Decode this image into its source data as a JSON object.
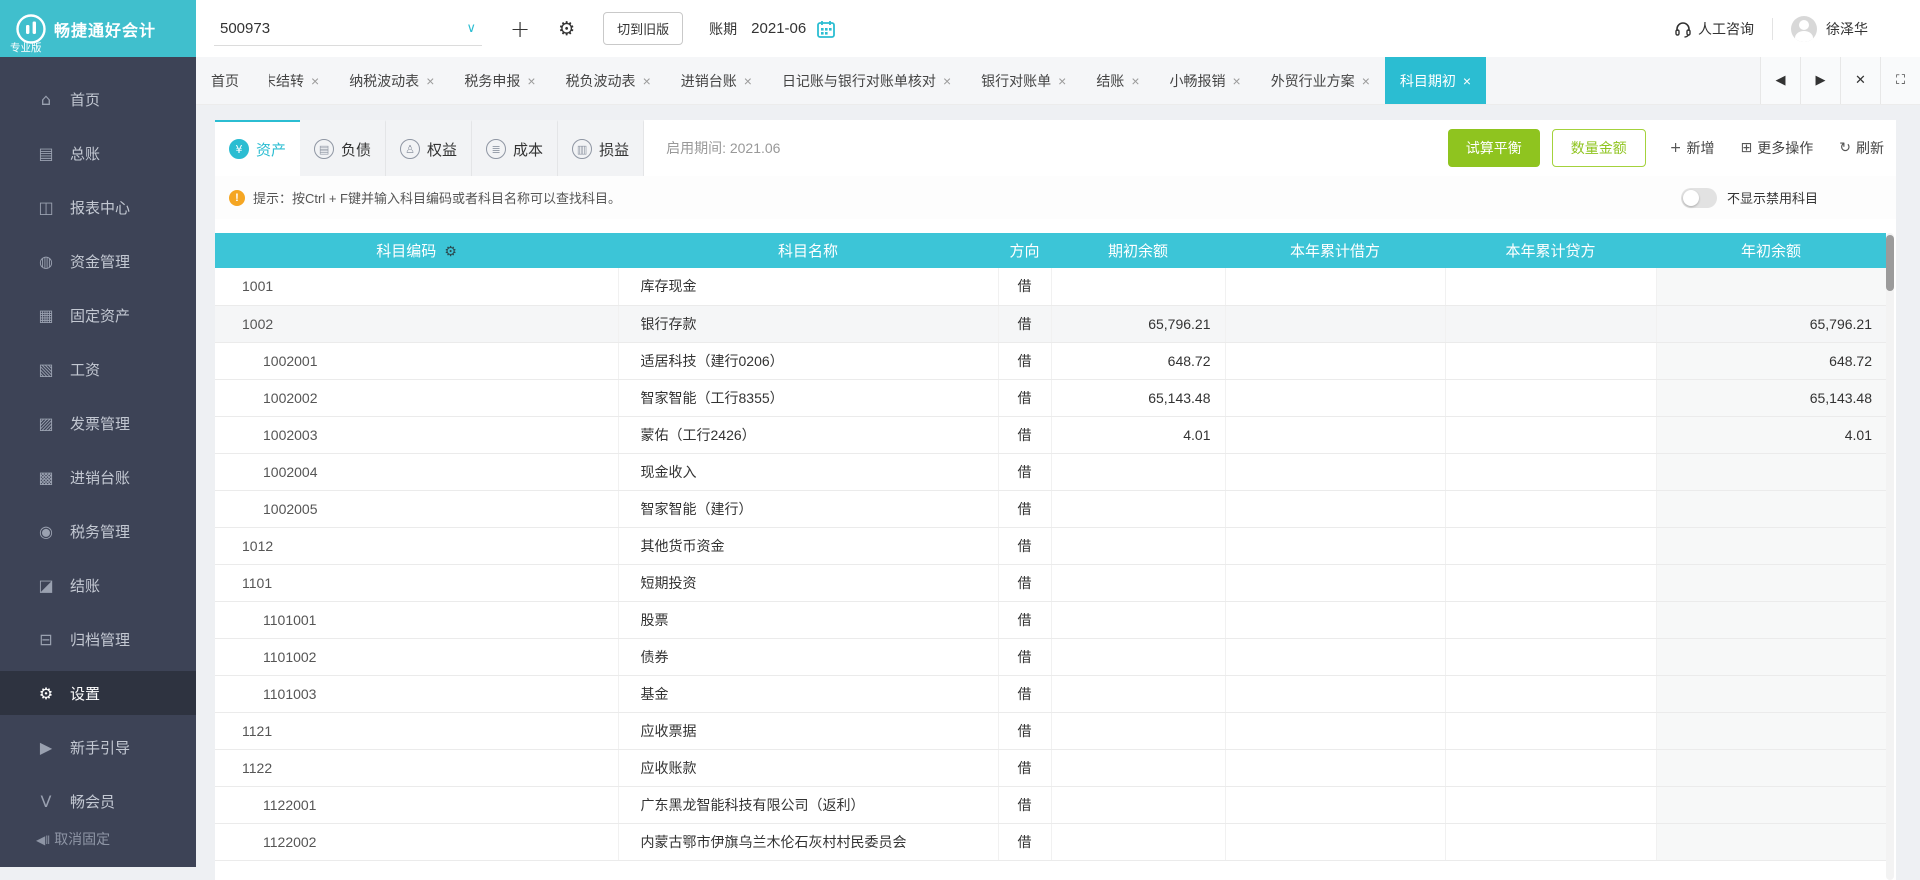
{
  "brand": {
    "name": "畅捷通好会计",
    "edition": "专业版"
  },
  "topbar": {
    "account_code": "500973",
    "switch_old_label": "切到旧版",
    "period_label": "账期",
    "period_value": "2021-06",
    "support_label": "人工咨询",
    "user_name": "徐泽华"
  },
  "tabbar": {
    "tabs": [
      {
        "label": "首页",
        "closable": false
      },
      {
        "label": "结转",
        "closable": true,
        "clipped": "末"
      },
      {
        "label": "纳税波动表",
        "closable": true
      },
      {
        "label": "税务申报",
        "closable": true
      },
      {
        "label": "税负波动表",
        "closable": true
      },
      {
        "label": "进销台账",
        "closable": true
      },
      {
        "label": "日记账与银行对账单核对",
        "closable": true
      },
      {
        "label": "银行对账单",
        "closable": true
      },
      {
        "label": "结账",
        "closable": true
      },
      {
        "label": "小畅报销",
        "closable": true
      },
      {
        "label": "外贸行业方案",
        "closable": true
      },
      {
        "label": "科目期初",
        "closable": true,
        "active": true
      }
    ],
    "controls": [
      {
        "name": "scroll-left-icon",
        "glyph": "◀"
      },
      {
        "name": "scroll-right-icon",
        "glyph": "▶"
      },
      {
        "name": "close-all-icon",
        "glyph": "✕"
      },
      {
        "name": "fullscreen-icon",
        "glyph": "⛶"
      }
    ]
  },
  "sidebar": {
    "items": [
      {
        "id": "home",
        "icon": "home-icon",
        "glyph": "⌂",
        "label": "首页"
      },
      {
        "id": "general-ledger",
        "icon": "ledger-icon",
        "glyph": "▤",
        "label": "总账"
      },
      {
        "id": "report-center",
        "icon": "report-icon",
        "glyph": "◫",
        "label": "报表中心"
      },
      {
        "id": "funds",
        "icon": "money-bag-icon",
        "glyph": "◍",
        "label": "资金管理"
      },
      {
        "id": "fixed-assets",
        "icon": "building-icon",
        "glyph": "▦",
        "label": "固定资产"
      },
      {
        "id": "payroll",
        "icon": "payroll-icon",
        "glyph": "▧",
        "label": "工资"
      },
      {
        "id": "invoice",
        "icon": "invoice-icon",
        "glyph": "▨",
        "label": "发票管理"
      },
      {
        "id": "purchase-sales",
        "icon": "daybook-icon",
        "glyph": "▩",
        "label": "进销台账"
      },
      {
        "id": "tax",
        "icon": "tax-icon",
        "glyph": "◉",
        "label": "税务管理"
      },
      {
        "id": "closing",
        "icon": "closing-icon",
        "glyph": "◪",
        "label": "结账"
      },
      {
        "id": "archive",
        "icon": "archive-icon",
        "glyph": "⊟",
        "label": "归档管理"
      },
      {
        "id": "settings",
        "icon": "gear-icon",
        "glyph": "⚙",
        "label": "设置",
        "active": true
      },
      {
        "id": "guide",
        "icon": "play-icon",
        "glyph": "▶",
        "label": "新手引导"
      },
      {
        "id": "member",
        "icon": "v-member-icon",
        "glyph": "Ⅴ",
        "label": "畅会员"
      }
    ],
    "unpin_label": "取消固定",
    "unpin_glyph": "◀‖"
  },
  "toolbar": {
    "subtabs": [
      {
        "id": "asset",
        "icon": "safe-icon",
        "glyph": "¥",
        "label": "资产",
        "active": true
      },
      {
        "id": "liability",
        "icon": "book-icon",
        "glyph": "▤",
        "label": "负债"
      },
      {
        "id": "equity",
        "icon": "person-icon",
        "glyph": "♙",
        "label": "权益"
      },
      {
        "id": "cost",
        "icon": "layers-icon",
        "glyph": "≣",
        "label": "成本"
      },
      {
        "id": "profit-loss",
        "icon": "statement-icon",
        "glyph": "▥",
        "label": "损益"
      }
    ],
    "enable_period": "启用期间: 2021.06",
    "trial_balance_label": "试算平衡",
    "qty_amount_label": "数量金额",
    "add_label": "新增",
    "add_glyph": "+",
    "more_label": "更多操作",
    "more_glyph": "⊞",
    "refresh_label": "刷新",
    "refresh_glyph": "↻"
  },
  "hint": {
    "icon_glyph": "!",
    "text": "提示：按Ctrl + F键并输入科目编码或者科目名称可以查找科目。",
    "toggle_label": "不显示禁用科目",
    "toggle_on": false
  },
  "table": {
    "columns": [
      "科目编码",
      "科目名称",
      "方向",
      "期初余额",
      "本年累计借方",
      "本年累计贷方",
      "年初余额"
    ],
    "rows": [
      {
        "code": "1001",
        "name": "库存现金",
        "dir": "借",
        "opening": "",
        "ytd_debit": "",
        "ytd_credit": "",
        "year_opening": "",
        "level": 1
      },
      {
        "code": "1002",
        "name": "银行存款",
        "dir": "借",
        "opening": "65,796.21",
        "ytd_debit": "",
        "ytd_credit": "",
        "year_opening": "65,796.21",
        "level": 1,
        "highlight": true
      },
      {
        "code": "1002001",
        "name": "适居科技（建行0206）",
        "dir": "借",
        "opening": "648.72",
        "ytd_debit": "",
        "ytd_credit": "",
        "year_opening": "648.72",
        "level": 2
      },
      {
        "code": "1002002",
        "name": "智家智能（工行8355）",
        "dir": "借",
        "opening": "65,143.48",
        "ytd_debit": "",
        "ytd_credit": "",
        "year_opening": "65,143.48",
        "level": 2
      },
      {
        "code": "1002003",
        "name": "蒙佑（工行2426）",
        "dir": "借",
        "opening": "4.01",
        "ytd_debit": "",
        "ytd_credit": "",
        "year_opening": "4.01",
        "level": 2
      },
      {
        "code": "1002004",
        "name": "现金收入",
        "dir": "借",
        "opening": "",
        "ytd_debit": "",
        "ytd_credit": "",
        "year_opening": "",
        "level": 2
      },
      {
        "code": "1002005",
        "name": "智家智能（建行）",
        "dir": "借",
        "opening": "",
        "ytd_debit": "",
        "ytd_credit": "",
        "year_opening": "",
        "level": 2
      },
      {
        "code": "1012",
        "name": "其他货币资金",
        "dir": "借",
        "opening": "",
        "ytd_debit": "",
        "ytd_credit": "",
        "year_opening": "",
        "level": 1
      },
      {
        "code": "1101",
        "name": "短期投资",
        "dir": "借",
        "opening": "",
        "ytd_debit": "",
        "ytd_credit": "",
        "year_opening": "",
        "level": 1
      },
      {
        "code": "1101001",
        "name": "股票",
        "dir": "借",
        "opening": "",
        "ytd_debit": "",
        "ytd_credit": "",
        "year_opening": "",
        "level": 2
      },
      {
        "code": "1101002",
        "name": "债券",
        "dir": "借",
        "opening": "",
        "ytd_debit": "",
        "ytd_credit": "",
        "year_opening": "",
        "level": 2
      },
      {
        "code": "1101003",
        "name": "基金",
        "dir": "借",
        "opening": "",
        "ytd_debit": "",
        "ytd_credit": "",
        "year_opening": "",
        "level": 2
      },
      {
        "code": "1121",
        "name": "应收票据",
        "dir": "借",
        "opening": "",
        "ytd_debit": "",
        "ytd_credit": "",
        "year_opening": "",
        "level": 1
      },
      {
        "code": "1122",
        "name": "应收账款",
        "dir": "借",
        "opening": "",
        "ytd_debit": "",
        "ytd_credit": "",
        "year_opening": "",
        "level": 1
      },
      {
        "code": "1122001",
        "name": "广东黑龙智能科技有限公司（返利）",
        "dir": "借",
        "opening": "",
        "ytd_debit": "",
        "ytd_credit": "",
        "year_opening": "",
        "level": 2
      },
      {
        "code": "1122002",
        "name": "内蒙古鄂市伊旗乌兰木伦石灰村村民委员会",
        "dir": "借",
        "opening": "",
        "ytd_debit": "",
        "ytd_credit": "",
        "year_opening": "",
        "level": 2
      }
    ]
  },
  "colors": {
    "brand_cyan": "#2bbdd2",
    "header_cyan": "#3cc5d7",
    "logo_teal": "#40bfcd",
    "sidebar_bg": "#3d4356",
    "green": "#8fc41f",
    "orange": "#f5a623"
  }
}
